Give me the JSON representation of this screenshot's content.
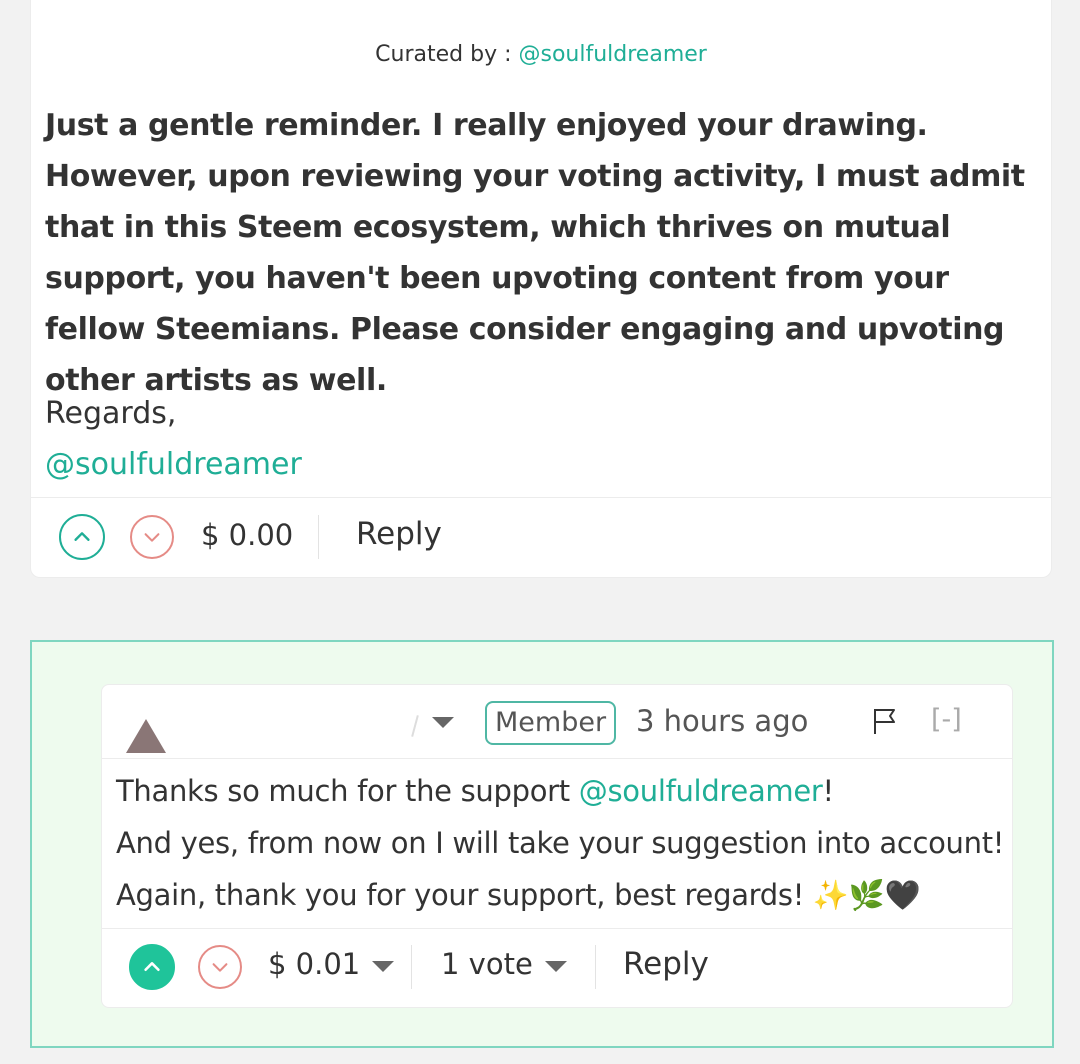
{
  "post_comment": {
    "curated_prefix": "Curated by : ",
    "curated_by": "@soulfuldreamer",
    "body": "Just a gentle reminder. I really enjoyed your drawing. However, upon reviewing your voting activity, I must admit that in this Steem ecosystem, which thrives on mutual support, you haven't been upvoting content from your fellow Steemians. Please consider engaging and upvoting other artists as well.",
    "regards": "Regards,",
    "signature": "@soulfuldreamer",
    "payout": "$ 0.00",
    "reply_label": "Reply"
  },
  "reply_comment": {
    "badge": "Member",
    "time_ago": "3 hours ago",
    "collapse": "[-]",
    "line1_pre": "Thanks so much for the support ",
    "line1_mention": "@soulfuldreamer",
    "line1_post": "!",
    "line2": "And yes, from now on I will take your suggestion into account!",
    "line3": "Again, thank you for your support, best regards! ✨🌿🖤",
    "payout": "$ 0.01",
    "votes": "1 vote",
    "reply_label": "Reply"
  },
  "colors": {
    "accent": "#1fae96",
    "upvote_filled": "#1fc49a",
    "downvote": "#e58b86",
    "highlight_bg": "#eefbee",
    "highlight_border": "#7fd6c0"
  },
  "icons": {
    "upvote": "chevron-up-icon",
    "downvote": "chevron-down-icon",
    "flag": "flag-icon",
    "dropdown": "caret-down-icon"
  }
}
